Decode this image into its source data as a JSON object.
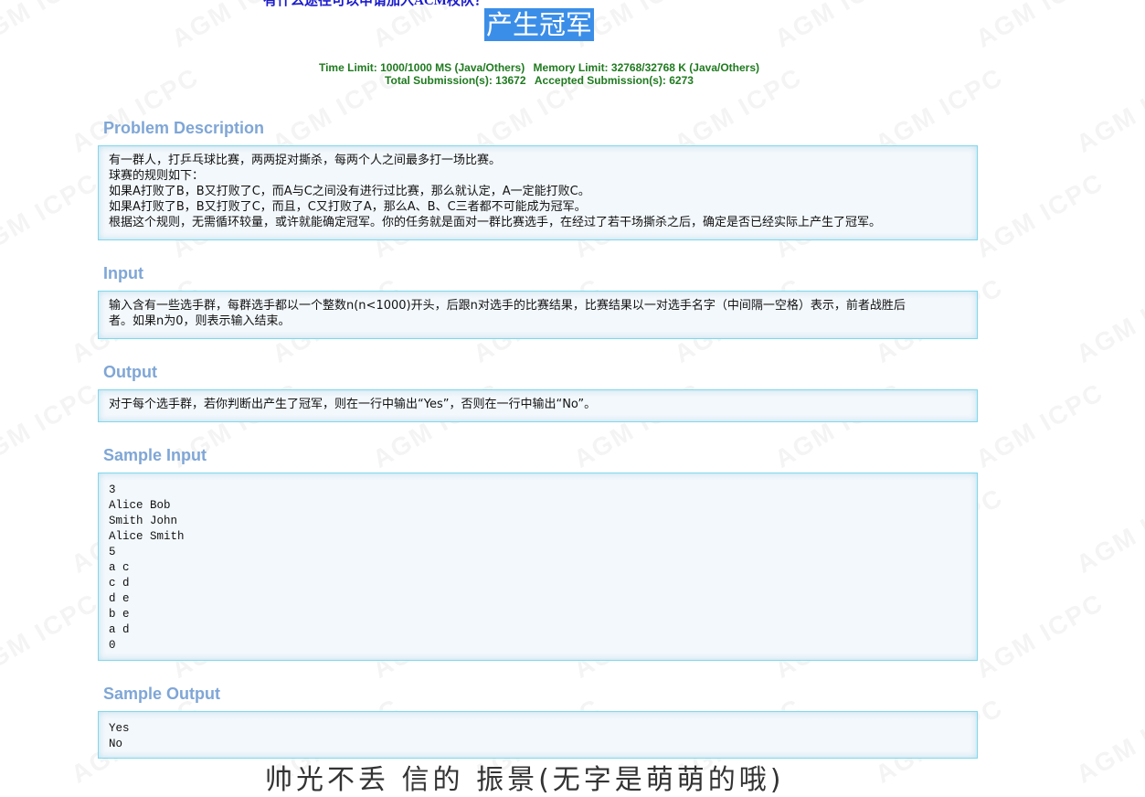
{
  "watermark_text": "AGM ICPC",
  "header": {
    "top_link": "有什么途径可以申请加入ACM校队？",
    "problem_title": "产生冠军",
    "time_limit": "Time Limit: 1000/1000 MS (Java/Others)",
    "memory_limit": "Memory Limit: 32768/32768 K (Java/Others)",
    "total_submissions": "Total Submission(s): 13672",
    "accepted_submissions": "Accepted Submission(s): 6273"
  },
  "sections": {
    "description": {
      "title": "Problem Description",
      "lines": [
        "有一群人，打乒乓球比赛，两两捉对撕杀，每两个人之间最多打一场比赛。",
        "球赛的规则如下：",
        "如果A打败了B，B又打败了C，而A与C之间没有进行过比赛，那么就认定，A一定能打败C。",
        "如果A打败了B，B又打败了C，而且，C又打败了A，那么A、B、C三者都不可能成为冠军。",
        "根据这个规则，无需循环较量，或许就能确定冠军。你的任务就是面对一群比赛选手，在经过了若干场撕杀之后，确定是否已经实际上产生了冠军。"
      ]
    },
    "input": {
      "title": "Input",
      "lines": [
        "输入含有一些选手群，每群选手都以一个整数n(n<1000)开头，后跟n对选手的比赛结果，比赛结果以一对选手名字（中间隔一空格）表示，前者战胜后",
        "者。如果n为0，则表示输入结束。"
      ]
    },
    "output": {
      "title": "Output",
      "lines": [
        "对于每个选手群，若你判断出产生了冠军，则在一行中输出“Yes”，否则在一行中输出“No”。"
      ]
    },
    "sample_input": {
      "title": "Sample Input",
      "lines": [
        "3",
        "Alice Bob",
        "Smith John",
        "Alice Smith",
        "5",
        "a c",
        "c d",
        "d e",
        "b e",
        "a d",
        "0"
      ]
    },
    "sample_output": {
      "title": "Sample Output",
      "lines": [
        "Yes",
        "No"
      ]
    }
  },
  "bottom_caption": "帅光不丢 信的 振景(无字是萌萌的哦)"
}
